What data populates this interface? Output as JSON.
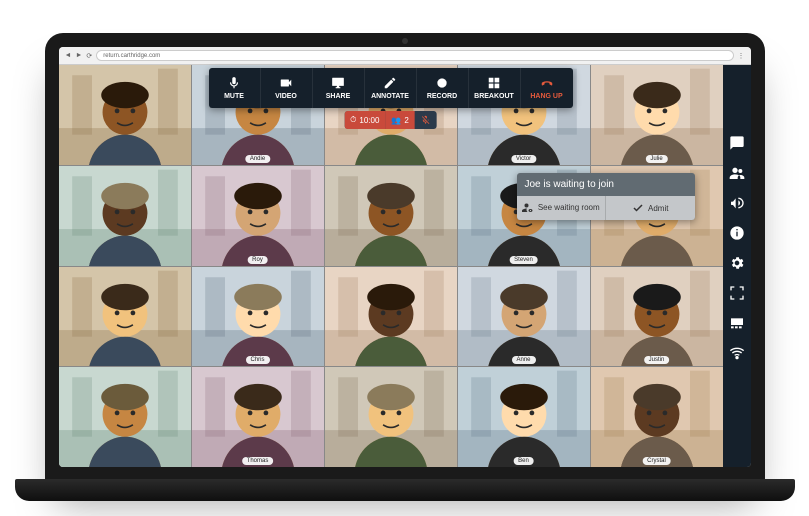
{
  "browser": {
    "url": "return.carthridge.com"
  },
  "toolbar": [
    {
      "id": "mute",
      "label": "MUTE"
    },
    {
      "id": "video",
      "label": "VIDEO"
    },
    {
      "id": "share",
      "label": "SHARE"
    },
    {
      "id": "annotate",
      "label": "ANNOTATE"
    },
    {
      "id": "record",
      "label": "RECORD"
    },
    {
      "id": "breakout",
      "label": "BREAKOUT"
    },
    {
      "id": "hangup",
      "label": "HANG UP"
    }
  ],
  "status": {
    "time": "10:00",
    "participants": "2"
  },
  "waiting": {
    "message": "Joe is waiting to join",
    "see_room": "See waiting room",
    "admit": "Admit"
  },
  "participants": [
    {
      "name": ""
    },
    {
      "name": "Andie"
    },
    {
      "name": ""
    },
    {
      "name": "Victor"
    },
    {
      "name": "Julie"
    },
    {
      "name": ""
    },
    {
      "name": "Roy"
    },
    {
      "name": ""
    },
    {
      "name": "Steven"
    },
    {
      "name": ""
    },
    {
      "name": ""
    },
    {
      "name": "Chris"
    },
    {
      "name": ""
    },
    {
      "name": "Anne"
    },
    {
      "name": "Justin"
    },
    {
      "name": ""
    },
    {
      "name": "Thomas"
    },
    {
      "name": ""
    },
    {
      "name": "Ben"
    },
    {
      "name": "Crystal"
    }
  ],
  "side_icons": [
    "chat",
    "people",
    "megaphone",
    "info",
    "settings",
    "fullscreen",
    "view",
    "wifi"
  ]
}
